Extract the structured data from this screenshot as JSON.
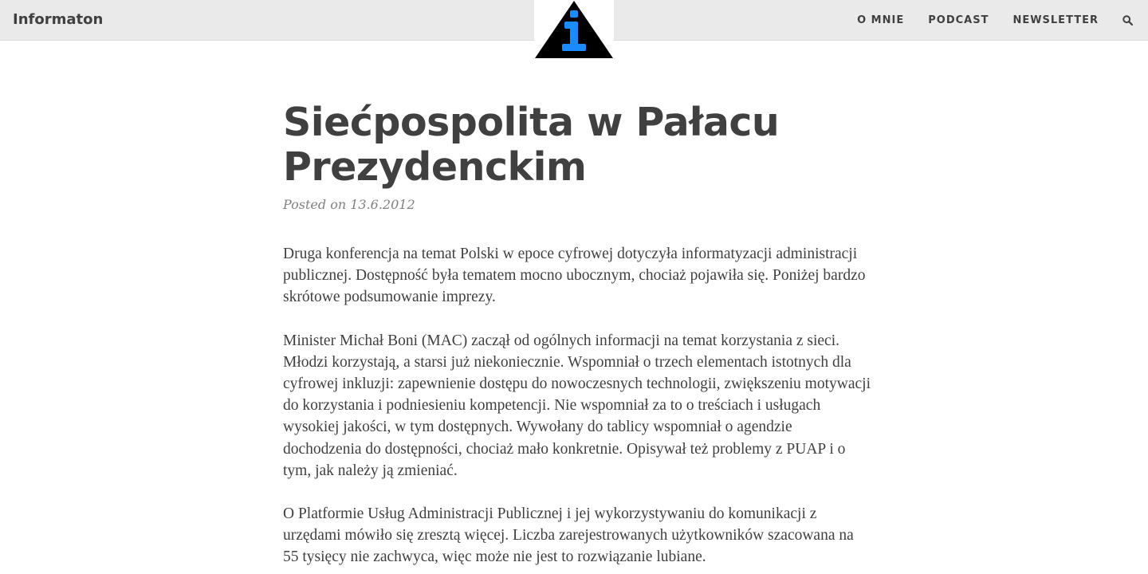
{
  "navbar": {
    "brand": "Informaton",
    "links": [
      {
        "label": "O MNIE"
      },
      {
        "label": "PODCAST"
      },
      {
        "label": "NEWSLETTER"
      }
    ],
    "search_icon": "search-icon"
  },
  "logo": {
    "icon": "info-triangle-logo",
    "colors": {
      "triangle": "#000000",
      "glyph": "#1a8cff"
    }
  },
  "post": {
    "title": "Siećpospolita w Pałacu Prezydenckim",
    "meta": "Posted on 13.6.2012",
    "paragraphs": [
      "Druga konferencja na temat Polski w epoce cyfrowej dotyczyła informatyzacji administracji publicznej. Dostępność była tematem mocno ubocznym, chociaż pojawiła się. Poniżej bardzo skrótowe podsumowanie imprezy.",
      "Minister Michał Boni (MAC) zaczął od ogólnych informacji na temat korzystania z sieci. Młodzi korzystają, a starsi już niekoniecznie. Wspomniał o trzech elementach istotnych dla cyfrowej inkluzji: zapewnienie dostępu do nowoczesnych technologii, zwiększeniu motywacji do korzystania i podniesieniu kompetencji. Nie wspomniał za to o treściach i usługach wysokiej jakości, w tym dostępnych. Wywołany do tablicy wspomniał o agendzie dochodzenia do dostępności, chociaż mało konkretnie. Opisywał też problemy z PUAP i o tym, jak należy ją zmieniać.",
      "O Platformie Usług Administracji Publicznej i jej wykorzystywaniu do komunikacji z urzędami mówiło się zresztą więcej. Liczba zarejestrowanych użytkowników szacowana na 55 tysięcy nie zachwyca, więc może nie jest to rozwiązanie lubiane."
    ]
  }
}
